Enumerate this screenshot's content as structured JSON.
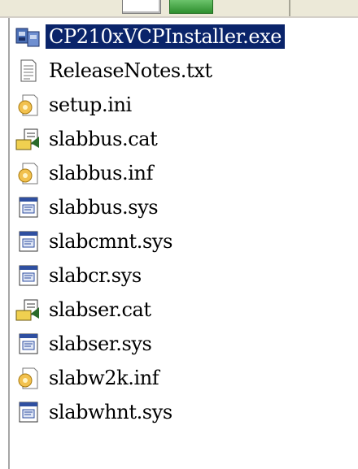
{
  "toolbar": {
    "buttons": [
      {
        "icon": "blank-window-icon"
      },
      {
        "icon": "green-go-icon"
      }
    ]
  },
  "files": [
    {
      "name": "CP210xVCPInstaller.exe",
      "icon": "installer-exe-icon",
      "selected": true
    },
    {
      "name": "ReleaseNotes.txt",
      "icon": "text-file-icon",
      "selected": false
    },
    {
      "name": "setup.ini",
      "icon": "settings-file-icon",
      "selected": false
    },
    {
      "name": "slabbus.cat",
      "icon": "security-catalog-icon",
      "selected": false
    },
    {
      "name": "slabbus.inf",
      "icon": "setup-info-icon",
      "selected": false
    },
    {
      "name": "slabbus.sys",
      "icon": "system-file-icon",
      "selected": false
    },
    {
      "name": "slabcmnt.sys",
      "icon": "system-file-icon",
      "selected": false
    },
    {
      "name": "slabcr.sys",
      "icon": "system-file-icon",
      "selected": false
    },
    {
      "name": "slabser.cat",
      "icon": "security-catalog-icon",
      "selected": false
    },
    {
      "name": "slabser.sys",
      "icon": "system-file-icon",
      "selected": false
    },
    {
      "name": "slabw2k.inf",
      "icon": "setup-info-icon",
      "selected": false
    },
    {
      "name": "slabwhnt.sys",
      "icon": "system-file-icon",
      "selected": false
    }
  ],
  "colors": {
    "selection_bg": "#0a246a",
    "selection_text": "#ffffff",
    "chrome": "#ece9d8"
  }
}
